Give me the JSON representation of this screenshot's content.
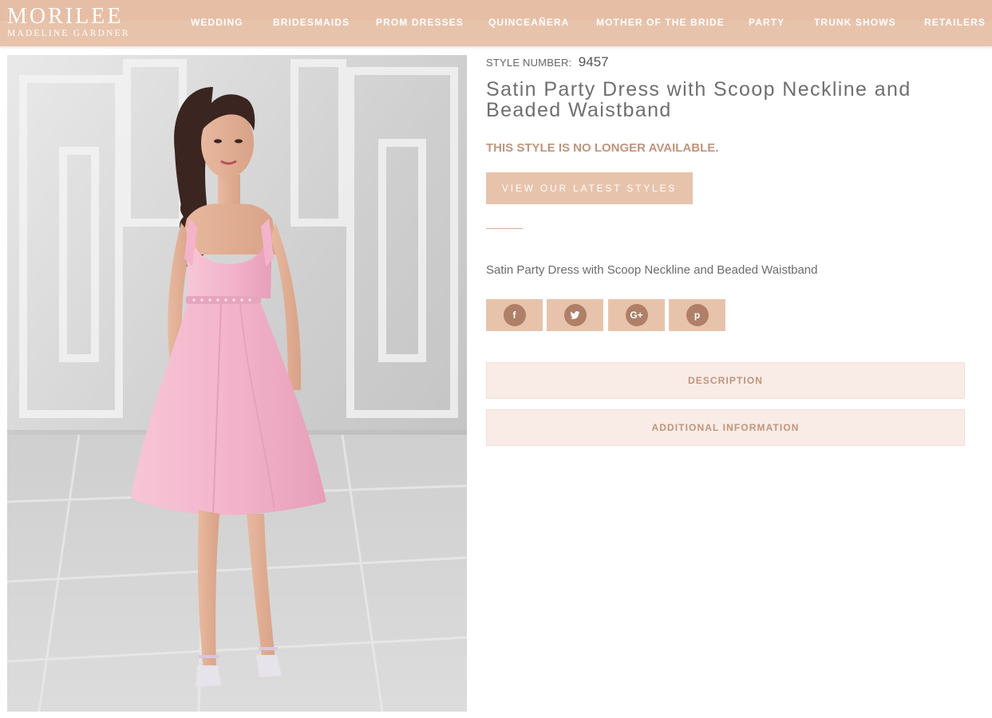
{
  "brand": {
    "logo_main": "MORILEE",
    "logo_sub": "MADELINE GARDNER"
  },
  "nav": {
    "items": [
      {
        "label": "WEDDING"
      },
      {
        "label": "BRIDESMAIDS"
      },
      {
        "label": "PROM DRESSES"
      },
      {
        "label": "QUINCEAÑERA"
      },
      {
        "label": "MOTHER OF THE BRIDE"
      },
      {
        "label": "PARTY"
      },
      {
        "label": "TRUNK SHOWS"
      },
      {
        "label": "RETAILERS"
      }
    ]
  },
  "product": {
    "style_label": "STYLE NUMBER:",
    "style_number": "9457",
    "title": "Satin Party Dress with Scoop Neckline and Beaded Waistband",
    "availability": "THIS STYLE IS NO LONGER AVAILABLE.",
    "latest_button": "VIEW OUR LATEST STYLES",
    "short_description": "Satin Party Dress with Scoop Neckline and Beaded Waistband"
  },
  "share": {
    "buttons": [
      {
        "icon": "facebook-icon",
        "glyph": "f"
      },
      {
        "icon": "twitter-icon",
        "glyph": "t"
      },
      {
        "icon": "google-plus-icon",
        "glyph": "G+"
      },
      {
        "icon": "pinterest-icon",
        "glyph": "p"
      }
    ]
  },
  "accordion": {
    "description_label": "DESCRIPTION",
    "additional_label": "ADDITIONAL INFORMATION"
  },
  "colors": {
    "accent": "#e8c3ac",
    "accent_text": "#c0957c",
    "accordion_bg": "#f9ebe6",
    "dress_pink": "#f3b4cb"
  }
}
